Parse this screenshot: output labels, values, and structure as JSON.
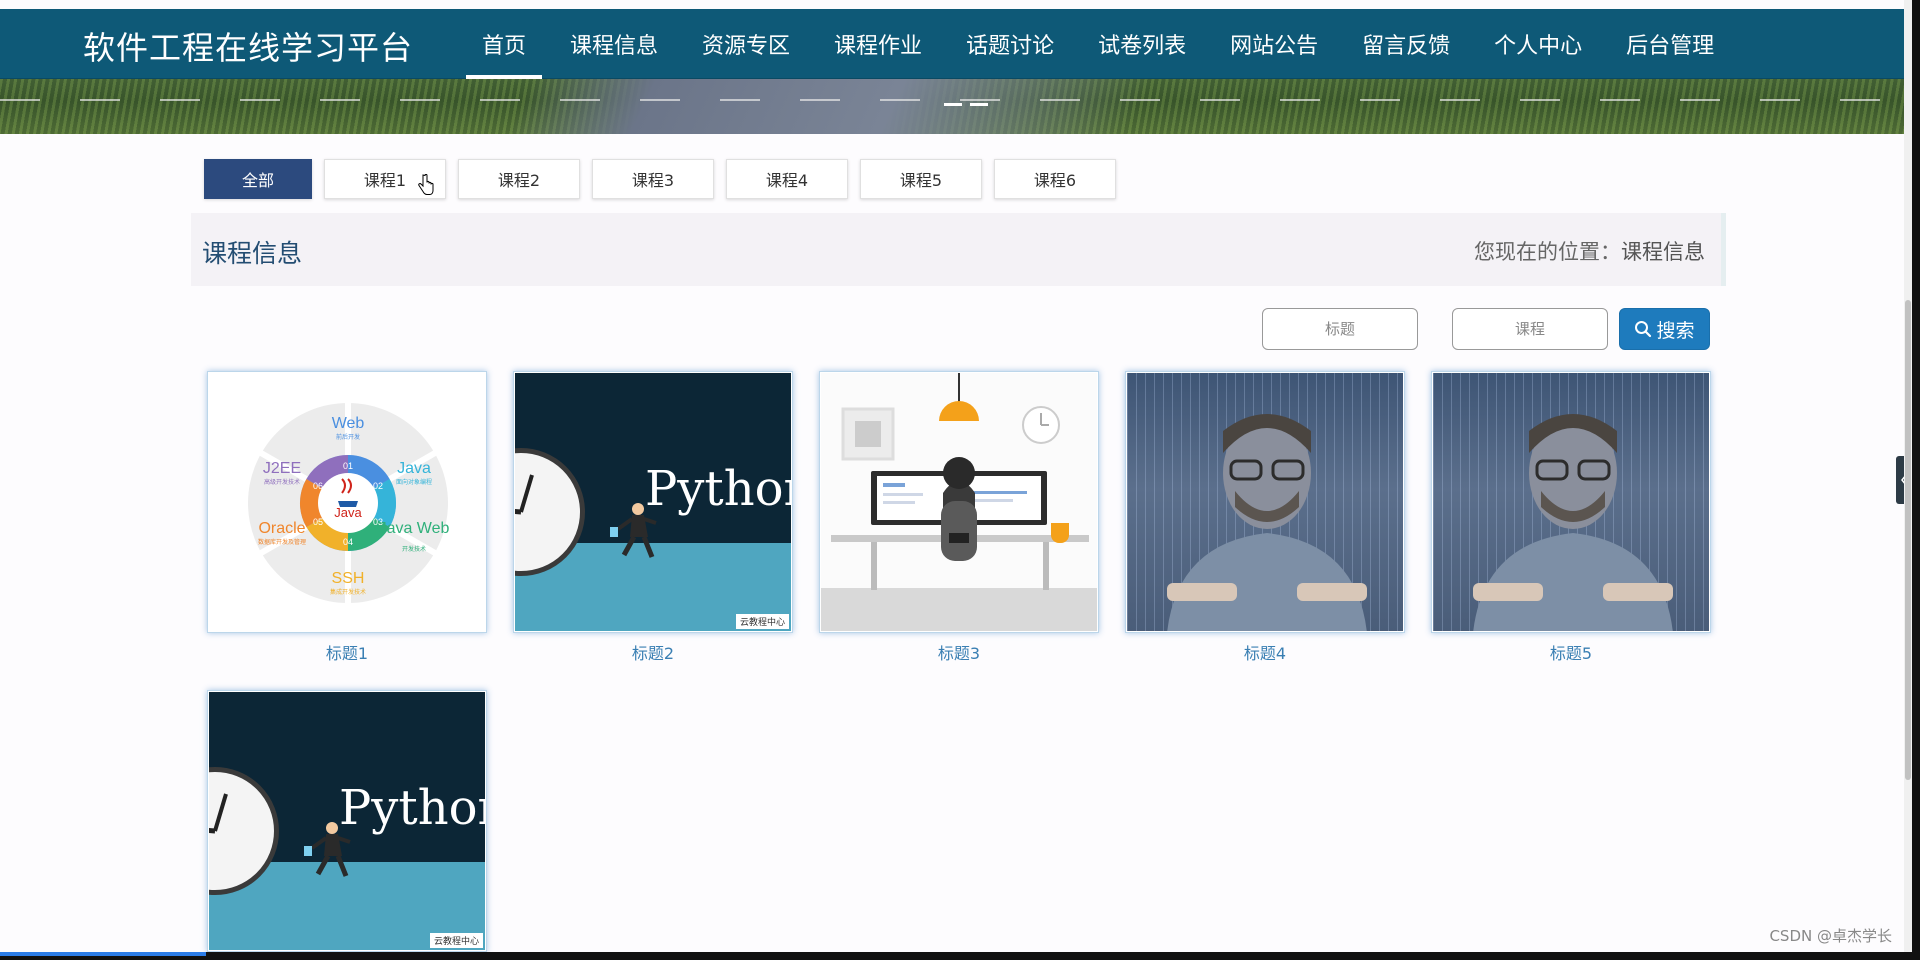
{
  "header": {
    "site_title": "软件工程在线学习平台",
    "nav": [
      {
        "label": "首页",
        "active": true
      },
      {
        "label": "课程信息"
      },
      {
        "label": "资源专区"
      },
      {
        "label": "课程作业"
      },
      {
        "label": "话题讨论"
      },
      {
        "label": "试卷列表"
      },
      {
        "label": "网站公告"
      },
      {
        "label": "留言反馈"
      },
      {
        "label": "个人中心"
      },
      {
        "label": "后台管理"
      }
    ]
  },
  "filters": {
    "tabs": [
      {
        "label": "全部",
        "active": true
      },
      {
        "label": "课程1"
      },
      {
        "label": "课程2"
      },
      {
        "label": "课程3"
      },
      {
        "label": "课程4"
      },
      {
        "label": "课程5"
      },
      {
        "label": "课程6"
      }
    ]
  },
  "section": {
    "title": "课程信息",
    "breadcrumb_prefix": "您现在的位置：",
    "breadcrumb_current": "课程信息"
  },
  "search": {
    "title_placeholder": "标题",
    "course_placeholder": "课程",
    "button_label": "搜索"
  },
  "cards": [
    {
      "caption": "标题1",
      "image": "java-roadmap"
    },
    {
      "caption": "标题2",
      "image": "python-clock"
    },
    {
      "caption": "标题3",
      "image": "developer-desk"
    },
    {
      "caption": "标题4",
      "image": "hacker-matrix"
    },
    {
      "caption": "标题5",
      "image": "hacker-matrix"
    },
    {
      "caption": "",
      "image": "python-clock"
    }
  ],
  "thumb_text": {
    "java": {
      "segments": [
        {
          "title": "Web",
          "sub": "前后开发",
          "num": "01"
        },
        {
          "title": "Java",
          "sub": "面向对象编程",
          "num": "02"
        },
        {
          "title": "Java Web",
          "sub": "开发技术",
          "num": "03"
        },
        {
          "title": "SSH",
          "sub": "集成开发技术",
          "num": "04"
        },
        {
          "title": "Oracle",
          "sub": "数据库开发及管理",
          "num": "05"
        },
        {
          "title": "J2EE",
          "sub": "高级开发技术",
          "num": "06"
        }
      ],
      "center": "Java"
    },
    "python": {
      "label": "Python",
      "tag": "云教程中心"
    }
  },
  "watermark": "CSDN @卓杰学长",
  "colors": {
    "header_bg": "#0e5977",
    "active_tab_bg": "#2c4a7e",
    "search_button_bg": "#1e7bbd",
    "caption_color": "#3a7fb3"
  }
}
